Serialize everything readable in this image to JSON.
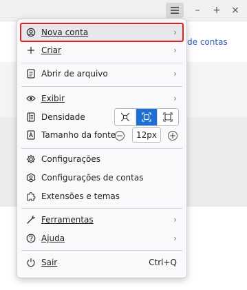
{
  "window": {
    "menu_icon": "hamburger-icon",
    "minimize_glyph": "–",
    "maximize_glyph": "+",
    "close_glyph": "×"
  },
  "background": {
    "link_text": "de contas"
  },
  "menu": {
    "new_account": {
      "label": "Nova conta",
      "icon": "add-account-icon"
    },
    "create": {
      "label": "Criar",
      "icon": "plus-icon"
    },
    "open_file": {
      "label": "Abrir de arquivo",
      "icon": "file-icon"
    },
    "view": {
      "label": "Exibir",
      "icon": "eye-icon"
    },
    "density": {
      "label": "Densidade",
      "icon": "density-icon",
      "selected": "normal"
    },
    "font_size": {
      "label": "Tamanho da fonte",
      "icon": "font-size-icon",
      "value": "12px"
    },
    "settings": {
      "label": "Configurações",
      "icon": "gear-icon"
    },
    "account_settings": {
      "label": "Configurações de contas",
      "icon": "account-settings-icon"
    },
    "addons": {
      "label": "Extensões e temas",
      "icon": "puzzle-icon"
    },
    "tools": {
      "label": "Ferramentas",
      "icon": "wrench-icon"
    },
    "help": {
      "label": "Ajuda",
      "icon": "help-icon"
    },
    "quit": {
      "label": "Sair",
      "icon": "power-icon",
      "shortcut": "Ctrl+Q"
    }
  },
  "colors": {
    "highlight_outline": "#e01f1f",
    "density_active": "#1f6fd1"
  }
}
